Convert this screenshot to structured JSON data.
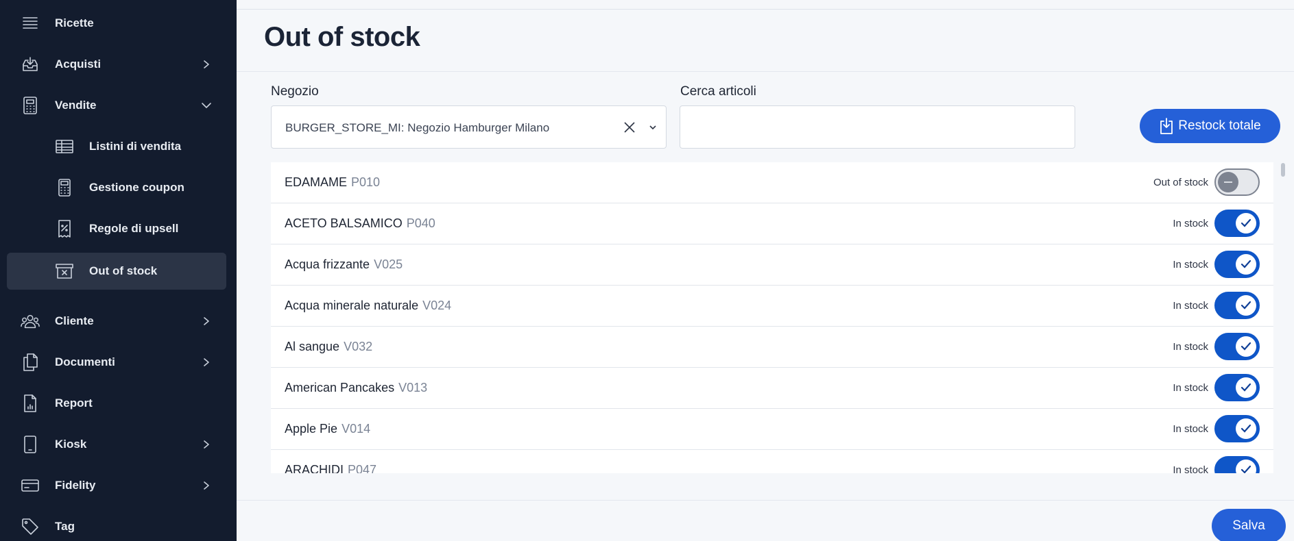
{
  "sidebar": {
    "items": [
      {
        "label": "Ricette",
        "icon": "list-icon"
      },
      {
        "label": "Acquisti",
        "icon": "inbox-download-icon"
      },
      {
        "label": "Vendite",
        "icon": "calculator-icon"
      },
      {
        "label": "Listini di vendita",
        "icon": "table-icon"
      },
      {
        "label": "Gestione coupon",
        "icon": "calculator-icon"
      },
      {
        "label": "Regole di upsell",
        "icon": "receipt-percent-icon"
      },
      {
        "label": "Out of stock",
        "icon": "archive-x-icon"
      },
      {
        "label": "Cliente",
        "icon": "users-icon"
      },
      {
        "label": "Documenti",
        "icon": "documents-icon"
      },
      {
        "label": "Report",
        "icon": "report-chart-icon"
      },
      {
        "label": "Kiosk",
        "icon": "tablet-icon"
      },
      {
        "label": "Fidelity",
        "icon": "card-icon"
      },
      {
        "label": "Tag",
        "icon": "tag-icon"
      }
    ]
  },
  "main": {
    "title": "Out of stock",
    "store_label": "Negozio",
    "store_value": "BURGER_STORE_MI: Negozio Hamburger Milano",
    "search_label": "Cerca articoli",
    "search_value": "",
    "restock_label": "Restock totale",
    "save_label": "Salva"
  },
  "items": [
    {
      "name": "EDAMAME",
      "code": "P010",
      "status": "Out of stock",
      "in_stock": false
    },
    {
      "name": "ACETO BALSAMICO",
      "code": "P040",
      "status": "In stock",
      "in_stock": true
    },
    {
      "name": "Acqua frizzante",
      "code": "V025",
      "status": "In stock",
      "in_stock": true
    },
    {
      "name": "Acqua minerale naturale",
      "code": "V024",
      "status": "In stock",
      "in_stock": true
    },
    {
      "name": "Al sangue",
      "code": "V032",
      "status": "In stock",
      "in_stock": true
    },
    {
      "name": "American Pancakes",
      "code": "V013",
      "status": "In stock",
      "in_stock": true
    },
    {
      "name": "Apple Pie",
      "code": "V014",
      "status": "In stock",
      "in_stock": true
    },
    {
      "name": "ARACHIDI",
      "code": "P047",
      "status": "In stock",
      "in_stock": true
    }
  ],
  "colors": {
    "sidebar_bg": "#131c2e",
    "accent": "#2560d8",
    "toggle_on": "#0f56c8"
  }
}
